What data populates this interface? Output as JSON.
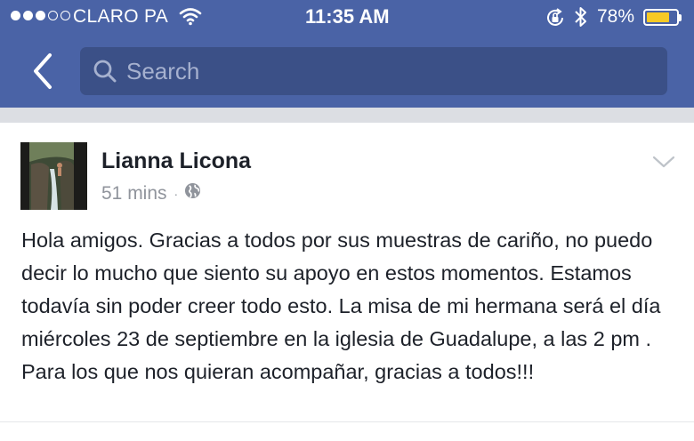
{
  "status_bar": {
    "carrier": "CLARO PA",
    "time": "11:35 AM",
    "battery_percent": "78%",
    "battery_level": 0.78,
    "signal_bars_filled": 3,
    "signal_bars_total": 5,
    "battery_color": "#f7c925",
    "icons": [
      "wifi-icon",
      "orientation-lock-icon",
      "bluetooth-icon",
      "battery-icon"
    ]
  },
  "nav": {
    "back_icon": "chevron-left-icon",
    "search_placeholder": "Search",
    "search_value": "",
    "bar_color": "#4a63a6"
  },
  "post": {
    "author": "Lianna Licona",
    "time_ago": "51 mins",
    "separator": "·",
    "audience_icon": "globe-icon",
    "options_icon": "chevron-down-icon",
    "text": "Hola amigos. Gracias a todos por sus muestras de cariño, no puedo decir lo mucho que siento su apoyo en estos momentos. Estamos todavía sin poder creer todo esto. La misa de mi hermana será el día miércoles 23 de septiembre en la iglesia de Guadalupe, a las 2 pm . Para los que nos quieran acompañar, gracias a todos!!!"
  }
}
